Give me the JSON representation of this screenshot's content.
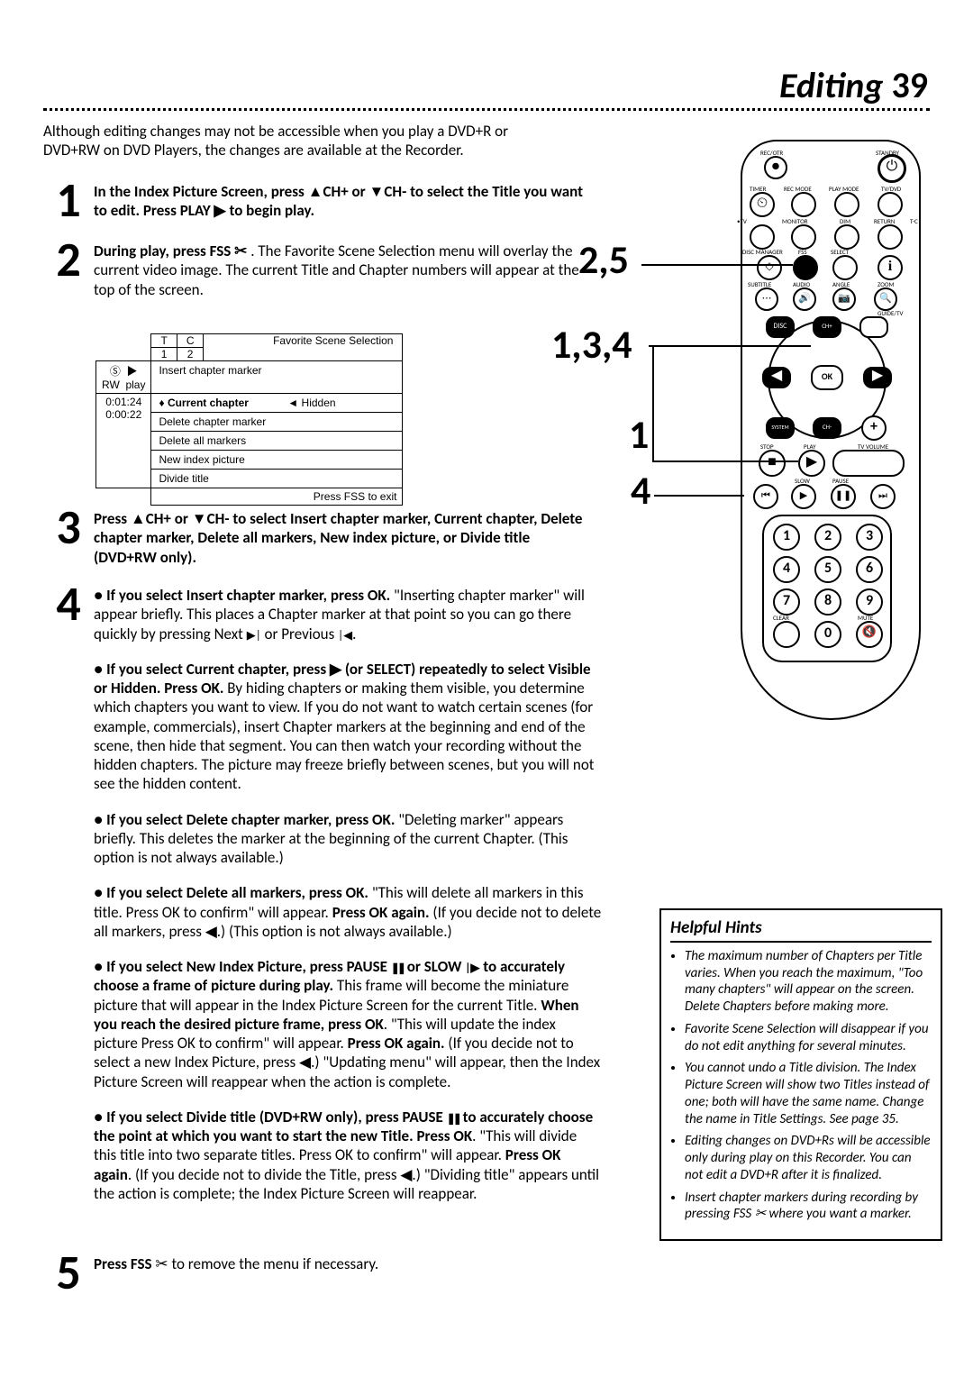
{
  "page": {
    "title": "Editing",
    "number": "39"
  },
  "intro": "Although editing changes may not be accessible when you play a DVD+R or DVD+RW on DVD Players, the changes are available at the Recorder.",
  "steps": {
    "s1": {
      "num": "1",
      "text_a": "In the Index Picture Screen, press ",
      "text_b": "CH+ or ",
      "text_c": "CH- to select the Title you want to edit. Press PLAY ",
      "text_d": " to begin play."
    },
    "s2": {
      "num": "2",
      "bold": "During play, press FSS ",
      "rest": " . The Favorite Scene Selection menu will overlay the current video image. The current Title and Chapter numbers will appear at the top of the screen."
    },
    "s3": {
      "num": "3",
      "text_a": "Press ",
      "text_b": "CH+ or ",
      "text_c": "CH- to select Insert chapter marker, Current chapter, Delete chapter marker, Delete all markers, New index picture, or Divide title (DVD+RW only)."
    },
    "s4": {
      "num": "4",
      "p1_bold": "If you select Insert chapter marker, press OK.",
      "p1_rest_a": " \"Inserting chapter marker\" will appear briefly. This places a Chapter marker at that point so you can go there quickly by pressing Next ",
      "p1_rest_b": " or Previous ",
      "p1_rest_c": ".",
      "p2_bold_a": "If you select Current chapter, press ",
      "p2_bold_b": " (or SELECT) repeatedly to select Visible or Hidden. Press OK.",
      "p2_rest": " By hiding chapters or making them visible, you determine which chapters you want to view. If you do not want to watch certain scenes (for example, commercials), insert Chapter markers at the beginning and end of the scene, then hide that segment. You can then watch your recording without the hidden chapters. The picture may freeze briefly between scenes, but you will not see the hidden content.",
      "p3_bold": "If you select Delete chapter marker, press OK.",
      "p3_rest": " \"Deleting marker\" appears briefly. This deletes the marker at the beginning of the current Chapter. (This option is not always available.)",
      "p4_bold": "If you select Delete all markers, press OK.",
      "p4_rest_a": " \"This will delete all markers in this title. Press OK to confirm\" will appear. ",
      "p4_bold2": "Press OK again.",
      "p4_rest_b": " (If you decide not to delete all markers, press ",
      "p4_rest_c": ".) (This option is not always available.)",
      "p5_bold_a": "If you select New Index Picture, press PAUSE ",
      "p5_bold_b": " or SLOW ",
      "p5_bold_c": " to accurately choose a frame of picture during play.",
      "p5_rest_a": " This frame will become the miniature picture that will appear in the Index Picture Screen for the current Title. ",
      "p5_bold2": "When you reach the desired picture frame, press OK",
      "p5_rest_b": ". \"This will update the index picture Press OK to confirm\" will appear. ",
      "p5_bold3": "Press OK again.",
      "p5_rest_c": " (If you decide not to select a new Index Picture, press ",
      "p5_rest_d": ".) \"Updating menu\" will appear, then the Index Picture Screen will reappear when the action is complete.",
      "p6_bold_a": "If you select Divide title (DVD+RW only), press PAUSE ",
      "p6_bold_b": " to accurately choose the point at which you want to start the new Title. Press OK",
      "p6_rest_a": ". \"This will divide this title into two separate titles. Press OK to confirm\" will appear. ",
      "p6_bold2": "Press OK again",
      "p6_rest_b": ". (If you decide not to divide the Title, press ",
      "p6_rest_c": ".) \"Dividing title\" appears until the action is complete; the Index Picture Screen will reappear."
    },
    "s5": {
      "num": "5",
      "text_a": "Press FSS ",
      "text_b": " to remove the menu if necessary."
    }
  },
  "menu": {
    "t_label": "T",
    "c_label": "C",
    "t_val": "1",
    "c_val": "2",
    "rw": "RW",
    "play": "play",
    "time1": "0:01:24",
    "time2": "0:00:22",
    "fav_title": "Favorite Scene Selection",
    "items": [
      "Insert chapter marker",
      "Current chapter",
      "Delete chapter marker",
      "Delete all markers",
      "New index picture",
      "Divide title"
    ],
    "hidden_label": "Hidden",
    "footer": "Press FSS to exit"
  },
  "remote": {
    "co25": "2,5",
    "co134": "1,3,4",
    "co1": "1",
    "co4": "4",
    "labels": {
      "rec_otr": "REC/OTR",
      "standby": "STANDBY",
      "timer": "TIMER",
      "rec_mode": "REC MODE",
      "play_mode": "PLAY MODE",
      "tv_dvd": "TV/DVD",
      "tv": "•TV",
      "monitor": "MONITOR",
      "dim": "DIM",
      "return": "RETURN",
      "tc": "T-C",
      "disc_manager": "DISC MANAGER",
      "fss": "FSS",
      "select": "SELECT",
      "info": "i",
      "subtitle": "SUBTITLE",
      "audio": "AUDIO",
      "angle": "ANGLE",
      "zoom": "ZOOM",
      "guide_tv": "GUIDE/TV",
      "disc": "DISC",
      "ch_plus": "CH+",
      "ch_minus": "CH-",
      "ok": "OK",
      "system": "SYSTEM",
      "stop": "STOP",
      "play": "PLAY",
      "tv_volume": "TV VOLUME",
      "slow": "SLOW",
      "pause": "PAUSE",
      "clear": "CLEAR",
      "mute": "MUTE"
    },
    "digits": [
      "1",
      "2",
      "3",
      "4",
      "5",
      "6",
      "7",
      "8",
      "9",
      "0"
    ]
  },
  "hints": {
    "title": "Helpful Hints",
    "items": [
      "The maximum number of Chapters per Title varies.  When you reach the maximum, \"Too many chapters\" will appear on the screen. Delete Chapters before making more.",
      "Favorite Scene Selection will disappear if you do not edit anything for several minutes.",
      "You cannot undo a Title division. The Index Picture Screen will show two Titles instead of one; both will have the same name. Change the name in Title Settings. See page 35.",
      "Editing changes on DVD+Rs will be accessible only during play on this Recorder. You can not edit a DVD+R after it is finalized.",
      "Insert chapter markers during recording by pressing FSS ✂ where you want a marker."
    ]
  }
}
